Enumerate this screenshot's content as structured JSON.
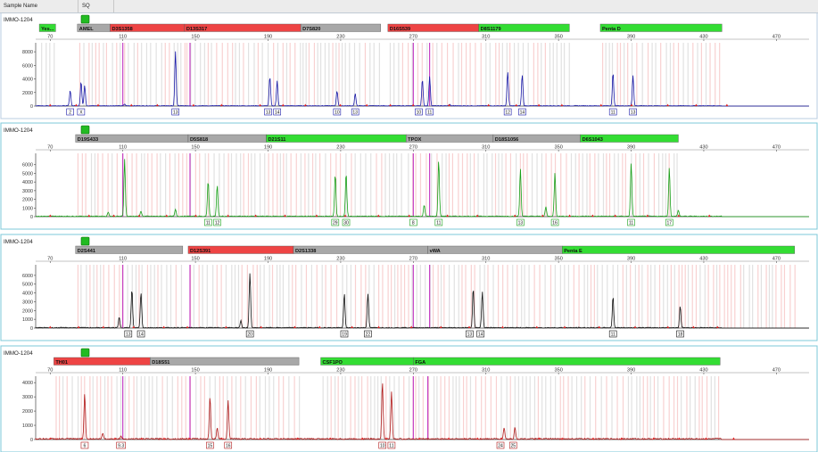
{
  "header": {
    "sample_name_label": "Sample Name",
    "sq_label": "SQ"
  },
  "x_axis": {
    "ticks": [
      70,
      110,
      150,
      190,
      230,
      270,
      310,
      350,
      390,
      430,
      470
    ],
    "range": [
      62,
      488
    ]
  },
  "colors": {
    "blue": "#1a1aa8",
    "green": "#18a018",
    "black": "#111111",
    "red": "#b01818",
    "marker_red": "#ee4444",
    "marker_green": "#33dd33",
    "marker_gray": "#a8a8a8",
    "magenta": "#c030c0",
    "check": "#22bb22"
  },
  "panels": [
    {
      "sample_label": "IMMO-1204",
      "color": "blue",
      "y_ticks": [
        0,
        2000,
        4000,
        6000,
        8000
      ],
      "y_max": 8800,
      "markers": [
        {
          "label": "Yes...",
          "color": "green",
          "start": 64,
          "end": 73
        },
        {
          "label": "AMEL",
          "color": "gray",
          "start": 85,
          "end": 103
        },
        {
          "label": "D3S1358",
          "color": "red",
          "start": 103,
          "end": 144
        },
        {
          "label": "D13S317",
          "color": "red",
          "start": 144,
          "end": 208
        },
        {
          "label": "D7S820",
          "color": "gray",
          "start": 208,
          "end": 252
        },
        {
          "label": "D16S539",
          "color": "red",
          "start": 256,
          "end": 306
        },
        {
          "label": "D8S1179",
          "color": "green",
          "start": 306,
          "end": 356
        },
        {
          "label": "Penta D",
          "color": "green",
          "start": 373,
          "end": 440
        }
      ],
      "peaks": [
        [
          81,
          2300
        ],
        [
          87,
          3600
        ],
        [
          89,
          3000
        ],
        [
          111,
          250
        ],
        [
          139,
          8000
        ],
        [
          191,
          4300
        ],
        [
          195,
          3700
        ],
        [
          228,
          2200
        ],
        [
          238,
          1800
        ],
        [
          275,
          3900
        ],
        [
          279,
          4300
        ],
        [
          290,
          200
        ],
        [
          322,
          5000
        ],
        [
          330,
          4600
        ],
        [
          380,
          4900
        ],
        [
          391,
          4500
        ]
      ],
      "allele_labels": [
        {
          "text": "2",
          "x": 81
        },
        {
          "text": "X",
          "x": 87
        },
        {
          "text": "13",
          "x": 139
        },
        {
          "text": "13",
          "x": 190
        },
        {
          "text": "14",
          "x": 195
        },
        {
          "text": "10",
          "x": 228
        },
        {
          "text": "13",
          "x": 238
        },
        {
          "text": "10",
          "x": 273
        },
        {
          "text": "11",
          "x": 279
        },
        {
          "text": "12",
          "x": 322
        },
        {
          "text": "14",
          "x": 330
        },
        {
          "text": "11",
          "x": 380
        },
        {
          "text": "13",
          "x": 391
        }
      ]
    },
    {
      "sample_label": "IMMO-1204",
      "color": "green",
      "y_ticks": [
        0,
        1000,
        2000,
        3000,
        4000,
        5000,
        6000
      ],
      "y_max": 6900,
      "markers": [
        {
          "label": "D19S433",
          "color": "gray",
          "start": 84,
          "end": 146
        },
        {
          "label": "D5S818",
          "color": "gray",
          "start": 146,
          "end": 189
        },
        {
          "label": "D21S11",
          "color": "green",
          "start": 189,
          "end": 266
        },
        {
          "label": "TPOX",
          "color": "gray",
          "start": 266,
          "end": 314
        },
        {
          "label": "D18S1056",
          "color": "gray",
          "start": 314,
          "end": 362
        },
        {
          "label": "D6S1043",
          "color": "green",
          "start": 362,
          "end": 416
        }
      ],
      "peaks": [
        [
          102,
          500
        ],
        [
          111,
          6600
        ],
        [
          120,
          600
        ],
        [
          139,
          800
        ],
        [
          157,
          4100
        ],
        [
          162,
          3600
        ],
        [
          227,
          4900
        ],
        [
          233,
          5000
        ],
        [
          276,
          1300
        ],
        [
          284,
          6500
        ],
        [
          329,
          5500
        ],
        [
          343,
          1100
        ],
        [
          348,
          5000
        ],
        [
          390,
          6100
        ],
        [
          411,
          5600
        ],
        [
          416,
          700
        ]
      ],
      "allele_labels": [
        {
          "text": "11",
          "x": 157
        },
        {
          "text": "12",
          "x": 162
        },
        {
          "text": "29",
          "x": 227
        },
        {
          "text": "30",
          "x": 233
        },
        {
          "text": "8",
          "x": 270
        },
        {
          "text": "11",
          "x": 284
        },
        {
          "text": "13",
          "x": 329
        },
        {
          "text": "16",
          "x": 348
        },
        {
          "text": "11",
          "x": 390
        },
        {
          "text": "17",
          "x": 411
        }
      ]
    },
    {
      "sample_label": "IMMO-1204",
      "color": "black",
      "y_ticks": [
        0,
        1000,
        2000,
        3000,
        4000,
        5000,
        6000
      ],
      "y_max": 6800,
      "markers": [
        {
          "label": "D2S441",
          "color": "gray",
          "start": 84,
          "end": 143
        },
        {
          "label": "D12S391",
          "color": "red",
          "start": 146,
          "end": 204
        },
        {
          "label": "D2S1338",
          "color": "gray",
          "start": 204,
          "end": 278
        },
        {
          "label": "vWA",
          "color": "gray",
          "start": 278,
          "end": 352
        },
        {
          "label": "Penta E",
          "color": "green",
          "start": 352,
          "end": 480
        }
      ],
      "peaks": [
        [
          108,
          1200
        ],
        [
          115,
          4400
        ],
        [
          120,
          4000
        ],
        [
          175,
          800
        ],
        [
          180,
          6200
        ],
        [
          232,
          3900
        ],
        [
          245,
          3900
        ],
        [
          303,
          4500
        ],
        [
          308,
          4100
        ],
        [
          380,
          3600
        ],
        [
          417,
          2500
        ]
      ],
      "allele_labels": [
        {
          "text": "13",
          "x": 113
        },
        {
          "text": "14",
          "x": 120
        },
        {
          "text": "20",
          "x": 180
        },
        {
          "text": "19",
          "x": 232
        },
        {
          "text": "22",
          "x": 245
        },
        {
          "text": "13",
          "x": 301
        },
        {
          "text": "14",
          "x": 307
        },
        {
          "text": "11",
          "x": 380
        },
        {
          "text": "18",
          "x": 417
        }
      ]
    },
    {
      "sample_label": "IMMO-1204",
      "color": "red",
      "y_ticks": [
        0,
        1000,
        2000,
        3000,
        4000
      ],
      "y_max": 4200,
      "markers": [
        {
          "label": "TH01",
          "color": "red",
          "start": 72,
          "end": 125
        },
        {
          "label": "D18S51",
          "color": "gray",
          "start": 125,
          "end": 207
        },
        {
          "label": "CSF1PO",
          "color": "green",
          "start": 219,
          "end": 270
        },
        {
          "label": "FGA",
          "color": "green",
          "start": 270,
          "end": 439
        }
      ],
      "peaks": [
        [
          89,
          3200
        ],
        [
          99,
          400
        ],
        [
          109,
          200
        ],
        [
          158,
          3000
        ],
        [
          162,
          800
        ],
        [
          168,
          2700
        ],
        [
          253,
          4000
        ],
        [
          258,
          3300
        ],
        [
          320,
          800
        ],
        [
          326,
          850
        ]
      ],
      "allele_labels": [
        {
          "text": "6",
          "x": 89
        },
        {
          "text": "9.3",
          "x": 109
        },
        {
          "text": "15",
          "x": 158
        },
        {
          "text": "16",
          "x": 168
        },
        {
          "text": "10",
          "x": 253
        },
        {
          "text": "11",
          "x": 258
        },
        {
          "text": "24",
          "x": 318
        },
        {
          "text": "25",
          "x": 325
        }
      ]
    }
  ]
}
